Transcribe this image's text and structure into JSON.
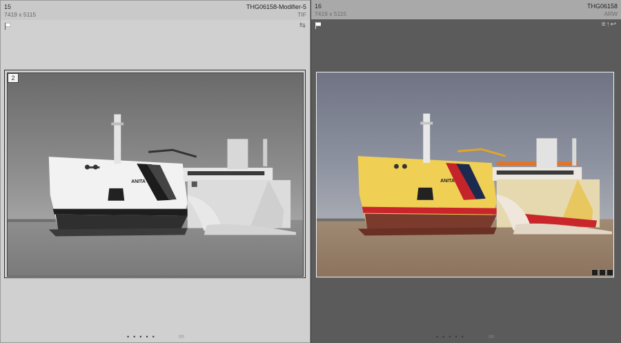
{
  "compare": {
    "left": {
      "index": "15",
      "dimensions": "7419 x 5115",
      "filename": "THG06158-Modifier-5",
      "filetype": "TIF",
      "badge_number": "2",
      "variant": "black-and-white"
    },
    "right": {
      "index": "16",
      "dimensions": "7419 x 5115",
      "filename": "THG06158",
      "filetype": "ARW",
      "variant": "color"
    }
  },
  "icons": {
    "flag": "flag-icon",
    "rotate": "rotate-icon",
    "corner": [
      "copy-icon",
      "grid-icon",
      "adjust-icon"
    ]
  },
  "photo_text": {
    "hull_name": "ANITA"
  },
  "colors": {
    "left_panel_bg": "#d0d0d0",
    "right_panel_bg": "#5b5b5b",
    "right_header_bg": "#a9a9a9"
  }
}
